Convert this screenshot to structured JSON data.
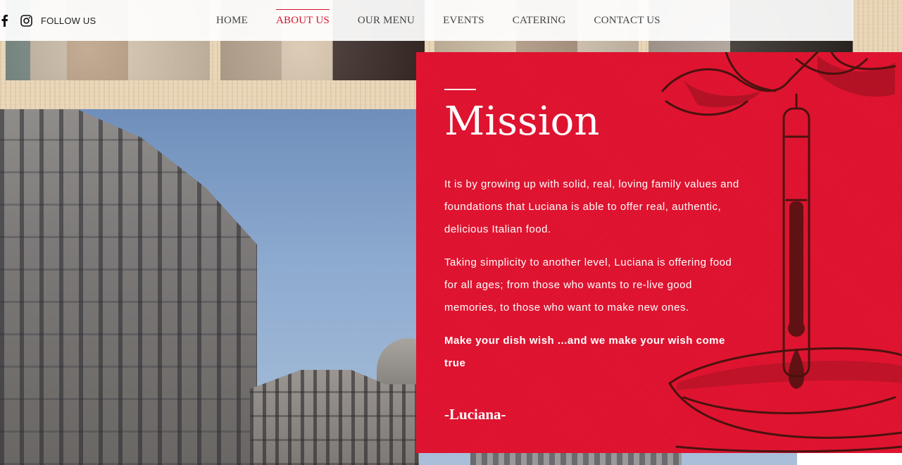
{
  "header": {
    "social": {
      "facebook_icon": "facebook-icon",
      "instagram_icon": "instagram-icon",
      "follow_label": "FOLLOW US"
    },
    "nav": [
      {
        "label": "HOME",
        "active": false
      },
      {
        "label": "ABOUT US",
        "active": true
      },
      {
        "label": "OUR MENU",
        "active": false
      },
      {
        "label": "EVENTS",
        "active": false
      },
      {
        "label": "CATERING",
        "active": false
      },
      {
        "label": "CONTACT US",
        "active": false
      }
    ]
  },
  "mission": {
    "title": "Mission",
    "paragraphs": [
      "It is by growing up with solid, real, loving family values and foundations that Luciana is able to offer real, authentic, delicious Italian food.",
      "Taking simplicity to another level, Luciana is offering food for all ages; from those who wants to re-live good memories, to those who want to make new ones."
    ],
    "tagline": "Make your dish wish ...and we make your wish come true",
    "signature": "-Luciana-"
  },
  "colors": {
    "accent": "#d3132e",
    "panel": "#e1122f",
    "illustration_ink": "#4a120f"
  }
}
